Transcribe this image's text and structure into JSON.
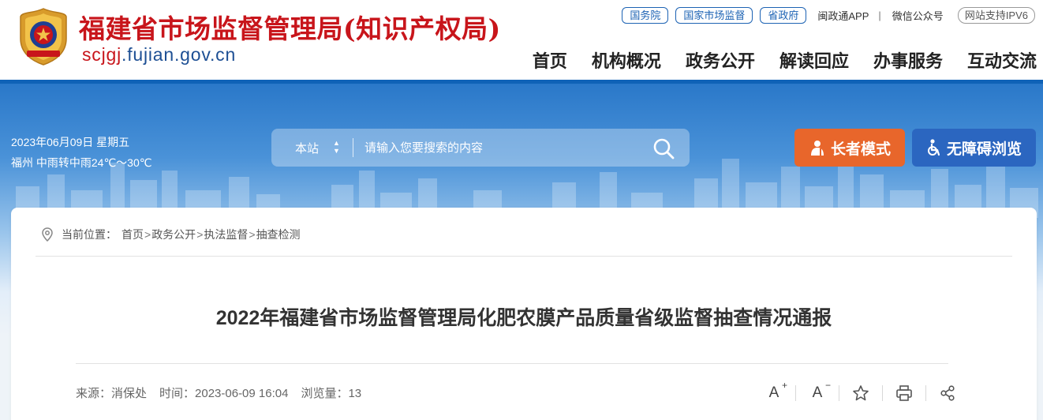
{
  "header": {
    "title": "福建省市场监督管理局(知识产权局)",
    "domain_highlight": "scjgj",
    "domain_rest": ".fujian.gov.cn",
    "top_links": {
      "state_council": "国务院",
      "samr": "国家市场监督",
      "province_gov": "省政府",
      "min_app": "闽政通APP",
      "separator": "|",
      "wechat": "微信公众号",
      "ipv6": "网站支持IPV6"
    },
    "nav": [
      "首页",
      "机构概况",
      "政务公开",
      "解读回应",
      "办事服务",
      "互动交流"
    ]
  },
  "banner": {
    "date": "2023年06月09日 星期五",
    "weather": "福州 中雨转中雨24℃～30℃",
    "search_scope": "本站",
    "search_placeholder": "请输入您要搜索的内容",
    "elder_mode": "长者模式",
    "accessibility": "无障碍浏览"
  },
  "breadcrumb": {
    "prefix": "当前位置：",
    "items": [
      "首页",
      "政务公开",
      "执法监督",
      "抽查检测"
    ],
    "separator": ">"
  },
  "article": {
    "title": "2022年福建省市场监督管理局化肥农膜产品质量省级监督抽查情况通报",
    "source": "来源：消保处",
    "time": "时间：2023-06-09 16:04",
    "views": "浏览量：13"
  },
  "tools": [
    "font-increase-icon",
    "font-decrease-icon",
    "favorite-icon",
    "print-icon",
    "share-icon"
  ],
  "colors": {
    "brand_red": "#c8151b",
    "brand_blue": "#0f62b7",
    "elder_orange": "#e8662b",
    "access_blue": "#2b66c0"
  }
}
